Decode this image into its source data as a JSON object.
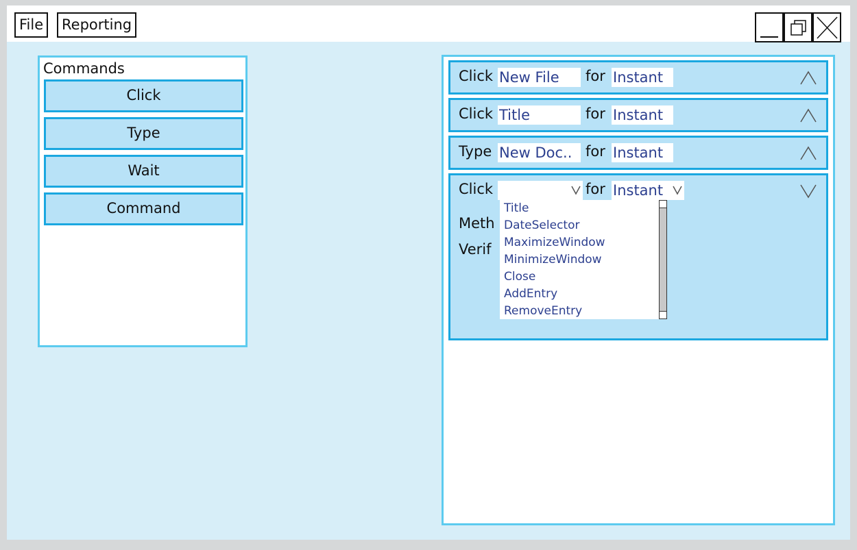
{
  "menu": {
    "file": "File",
    "reporting": "Reporting"
  },
  "commands": {
    "title": "Commands",
    "buttons": [
      "Click",
      "Type",
      "Wait",
      "Command"
    ]
  },
  "sequence": {
    "rows": [
      {
        "action": "Click",
        "target": "New File",
        "for_label": "for",
        "duration": "Instant",
        "chevron": "up-chevron-icon"
      },
      {
        "action": "Click",
        "target": "Title",
        "for_label": "for",
        "duration": "Instant",
        "chevron": "up-chevron-icon"
      },
      {
        "action": "Type",
        "target": "New Doc..",
        "for_label": "for",
        "duration": "Instant",
        "chevron": "up-chevron-icon"
      },
      {
        "action": "Click",
        "target": "",
        "for_label": "for",
        "duration": "Instant",
        "chevron": "down-chevron-icon",
        "method_label": "Meth",
        "verify_label": "Verif"
      }
    ],
    "dropdown_options": [
      "Title",
      "DateSelector",
      "MaximizeWindow",
      "MinimizeWindow",
      "Close",
      "AddEntry",
      "RemoveEntry"
    ]
  },
  "colors": {
    "accent": "#1aa7e0",
    "panel_border": "#5ccbef",
    "row_fill": "#b8e2f7",
    "background": "#d7eef8",
    "value_text": "#2c3f8f"
  }
}
